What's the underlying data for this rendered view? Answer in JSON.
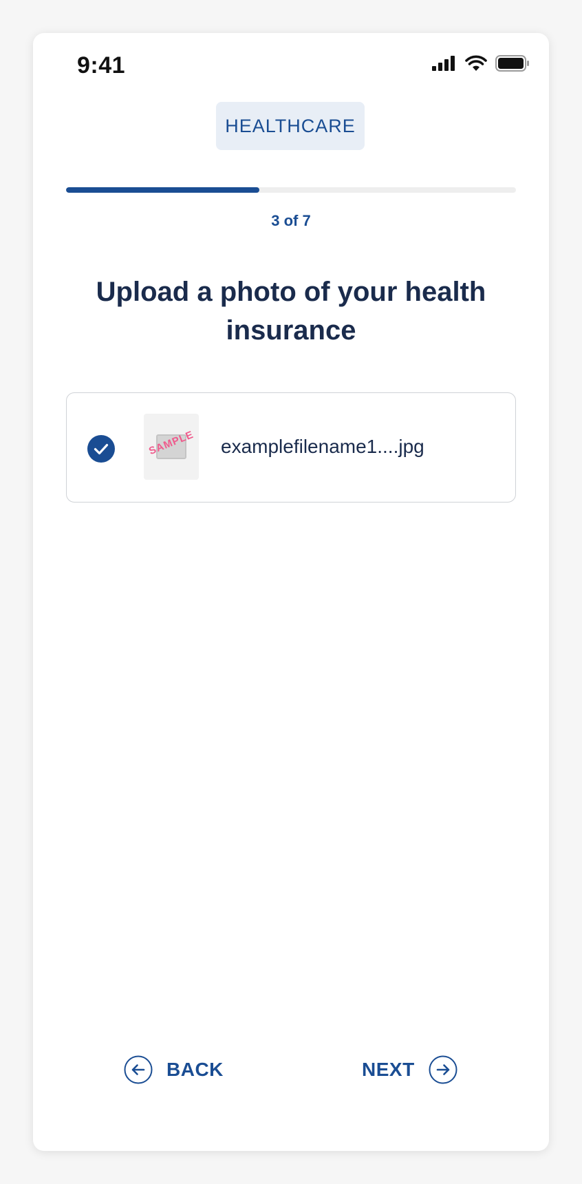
{
  "status_bar": {
    "time": "9:41",
    "icons": [
      "signal-icon",
      "wifi-icon",
      "battery-icon"
    ]
  },
  "header": {
    "category": "HEALTHCARE"
  },
  "progress": {
    "step_text": "3 of 7",
    "current_step": 3,
    "total_steps": 7,
    "fill_fraction": 0.43
  },
  "main": {
    "title": "Upload a photo of your health insurance",
    "uploaded_file": {
      "name": "examplefilename1....jpg",
      "status": "uploaded",
      "thumbnail_stamp": "SAMPLE"
    }
  },
  "footer": {
    "back_label": "BACK",
    "next_label": "NEXT"
  },
  "colors": {
    "accent": "#1a4d93",
    "title_text": "#1a2b4c",
    "chip_background": "#e8eef6",
    "progress_track": "#eeeeee",
    "card_border": "#cfd2d6",
    "stamp": "#ef5b8c"
  }
}
